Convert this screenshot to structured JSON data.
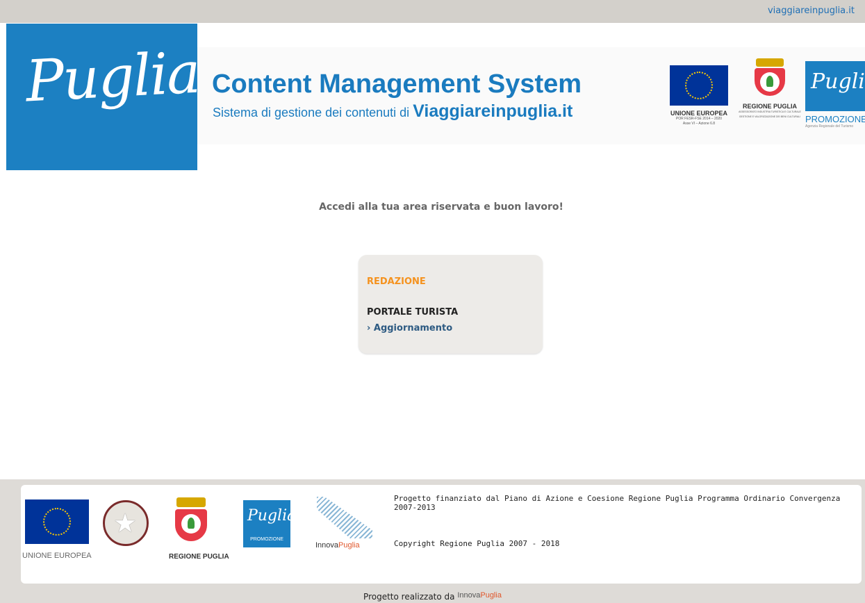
{
  "topbar": {
    "link": "viaggiareinpuglia.it"
  },
  "header": {
    "logo_text": "Puglia",
    "title": "Content Management System",
    "subtitle_prefix": "Sistema di gestione dei contenuti di ",
    "subtitle_brand": "Viaggiareinpuglia.it"
  },
  "partners": {
    "eu": {
      "title": "UNIONE EUROPEA",
      "line1": "POR FESR-FSE 2014 – 2020",
      "line2": "Asse VI – Azione 6.8"
    },
    "rp": {
      "title": "REGIONE PUGLIA",
      "line1": "ASSESSORATO INDUSTRIA TURISTICA E CULTURALE",
      "line2": "GESTIONE E VALORIZZAZIONE DEI BENI CULTURALI"
    },
    "promo": {
      "logo": "Puglia",
      "label": "PROMOZIONE",
      "small": "Agenzia Regionale del Turismo"
    }
  },
  "main": {
    "welcome": "Accedi alla tua area riservata e buon lavoro!",
    "card": {
      "section": "REDAZIONE",
      "subsection": "PORTALE TURISTA",
      "link": "› Aggiornamento"
    }
  },
  "footer": {
    "eu_label": "UNIONE EUROPEA",
    "rp_label": "REGIONE PUGLIA",
    "promo_logo": "Puglia",
    "promo_label": "PROMOZIONE",
    "innova_prefix": "Innova",
    "innova_suffix": "Puglia",
    "funding_text": "Progetto finanziato dal Piano di Azione e Coesione Regione Puglia Programma Ordinario Convergenza 2007-2013",
    "copyright": "Copyright Regione Puglia 2007 - 2018",
    "credit_text": "Progetto realizzato da ",
    "credit_brand_prefix": "Innova",
    "credit_brand_suffix": "Puglia"
  },
  "colors": {
    "brand_blue": "#1c80c2",
    "accent_orange": "#f5921e",
    "link_blue": "#2d5a82"
  }
}
